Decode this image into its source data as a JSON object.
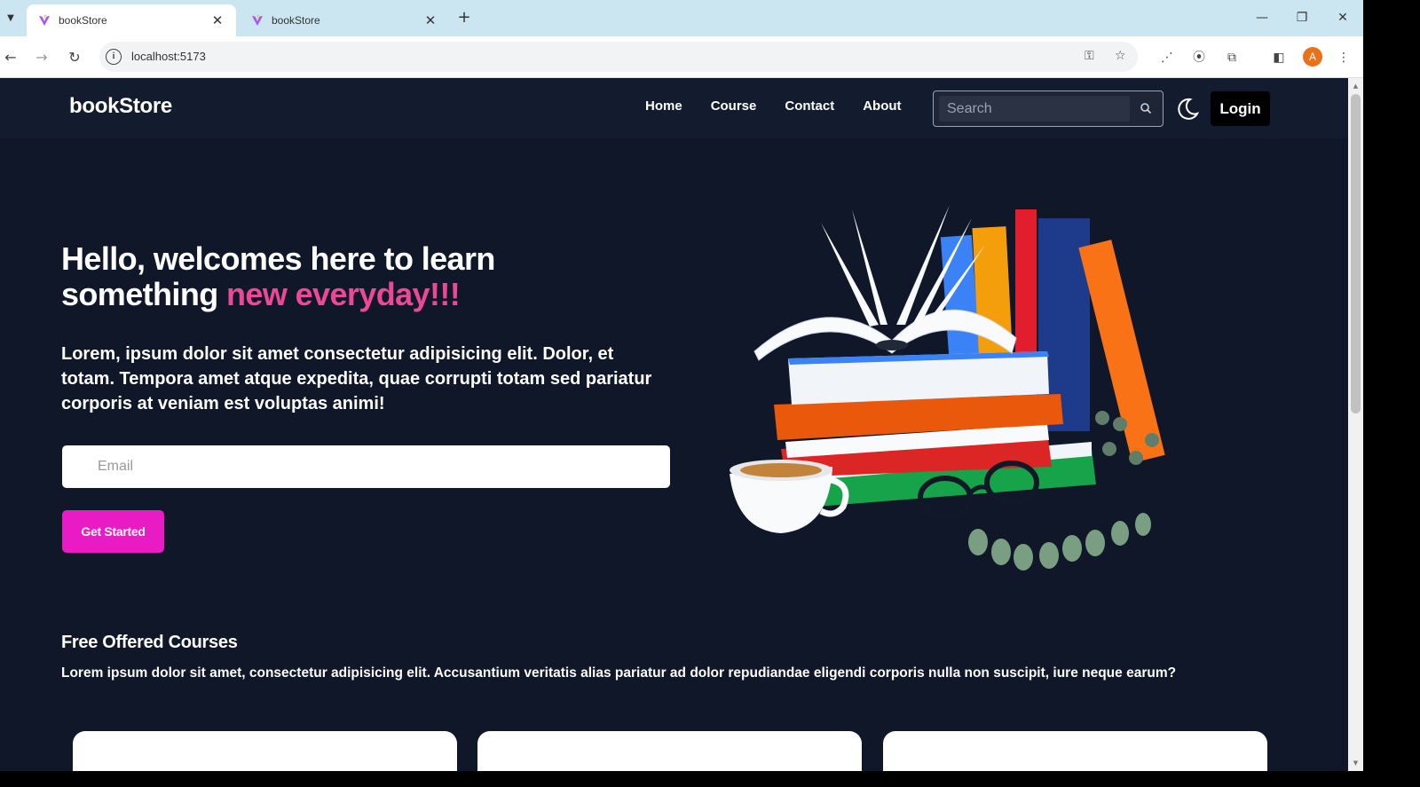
{
  "browser": {
    "tabs": [
      {
        "title": "bookStore",
        "active": true
      },
      {
        "title": "bookStore",
        "active": false
      }
    ],
    "url": "localhost:5173",
    "profile_initial": "A"
  },
  "navbar": {
    "brand": "bookStore",
    "links": [
      "Home",
      "Course",
      "Contact",
      "About"
    ],
    "search_placeholder": "Search",
    "login_label": "Login"
  },
  "hero": {
    "title_main": "Hello, welcomes here to learn something ",
    "title_accent": "new everyday!!!",
    "description": "Lorem, ipsum dolor sit amet consectetur adipisicing elit. Dolor, et totam. Tempora amet atque expedita, quae corrupti totam sed pariatur corporis at veniam est voluptas animi!",
    "email_placeholder": "Email",
    "cta_label": "Get Started"
  },
  "courses": {
    "title": "Free Offered Courses",
    "description": "Lorem ipsum dolor sit amet, consectetur adipisicing elit. Accusantium veritatis alias pariatur ad dolor repudiandae eligendi corporis nulla non suscipit, iure neque earum?"
  },
  "colors": {
    "page_bg": "#0f1729",
    "navbar_bg": "#131c2e",
    "accent_pink": "#ec4899",
    "cta_magenta": "#e81bc4"
  }
}
